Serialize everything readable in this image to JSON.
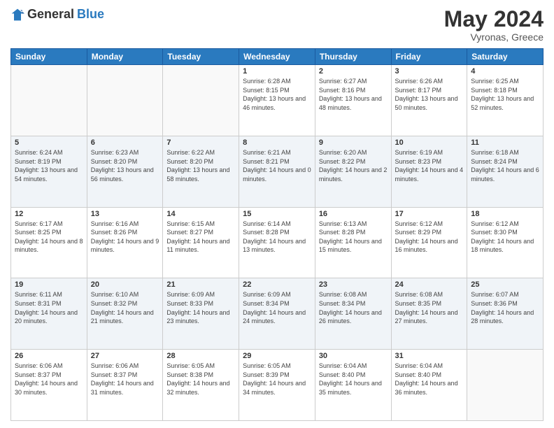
{
  "header": {
    "logo_general": "General",
    "logo_blue": "Blue",
    "month_year": "May 2024",
    "location": "Vyronas, Greece"
  },
  "weekdays": [
    "Sunday",
    "Monday",
    "Tuesday",
    "Wednesday",
    "Thursday",
    "Friday",
    "Saturday"
  ],
  "weeks": [
    [
      {
        "day": "",
        "sunrise": "",
        "sunset": "",
        "daylight": ""
      },
      {
        "day": "",
        "sunrise": "",
        "sunset": "",
        "daylight": ""
      },
      {
        "day": "",
        "sunrise": "",
        "sunset": "",
        "daylight": ""
      },
      {
        "day": "1",
        "sunrise": "Sunrise: 6:28 AM",
        "sunset": "Sunset: 8:15 PM",
        "daylight": "Daylight: 13 hours and 46 minutes."
      },
      {
        "day": "2",
        "sunrise": "Sunrise: 6:27 AM",
        "sunset": "Sunset: 8:16 PM",
        "daylight": "Daylight: 13 hours and 48 minutes."
      },
      {
        "day": "3",
        "sunrise": "Sunrise: 6:26 AM",
        "sunset": "Sunset: 8:17 PM",
        "daylight": "Daylight: 13 hours and 50 minutes."
      },
      {
        "day": "4",
        "sunrise": "Sunrise: 6:25 AM",
        "sunset": "Sunset: 8:18 PM",
        "daylight": "Daylight: 13 hours and 52 minutes."
      }
    ],
    [
      {
        "day": "5",
        "sunrise": "Sunrise: 6:24 AM",
        "sunset": "Sunset: 8:19 PM",
        "daylight": "Daylight: 13 hours and 54 minutes."
      },
      {
        "day": "6",
        "sunrise": "Sunrise: 6:23 AM",
        "sunset": "Sunset: 8:20 PM",
        "daylight": "Daylight: 13 hours and 56 minutes."
      },
      {
        "day": "7",
        "sunrise": "Sunrise: 6:22 AM",
        "sunset": "Sunset: 8:20 PM",
        "daylight": "Daylight: 13 hours and 58 minutes."
      },
      {
        "day": "8",
        "sunrise": "Sunrise: 6:21 AM",
        "sunset": "Sunset: 8:21 PM",
        "daylight": "Daylight: 14 hours and 0 minutes."
      },
      {
        "day": "9",
        "sunrise": "Sunrise: 6:20 AM",
        "sunset": "Sunset: 8:22 PM",
        "daylight": "Daylight: 14 hours and 2 minutes."
      },
      {
        "day": "10",
        "sunrise": "Sunrise: 6:19 AM",
        "sunset": "Sunset: 8:23 PM",
        "daylight": "Daylight: 14 hours and 4 minutes."
      },
      {
        "day": "11",
        "sunrise": "Sunrise: 6:18 AM",
        "sunset": "Sunset: 8:24 PM",
        "daylight": "Daylight: 14 hours and 6 minutes."
      }
    ],
    [
      {
        "day": "12",
        "sunrise": "Sunrise: 6:17 AM",
        "sunset": "Sunset: 8:25 PM",
        "daylight": "Daylight: 14 hours and 8 minutes."
      },
      {
        "day": "13",
        "sunrise": "Sunrise: 6:16 AM",
        "sunset": "Sunset: 8:26 PM",
        "daylight": "Daylight: 14 hours and 9 minutes."
      },
      {
        "day": "14",
        "sunrise": "Sunrise: 6:15 AM",
        "sunset": "Sunset: 8:27 PM",
        "daylight": "Daylight: 14 hours and 11 minutes."
      },
      {
        "day": "15",
        "sunrise": "Sunrise: 6:14 AM",
        "sunset": "Sunset: 8:28 PM",
        "daylight": "Daylight: 14 hours and 13 minutes."
      },
      {
        "day": "16",
        "sunrise": "Sunrise: 6:13 AM",
        "sunset": "Sunset: 8:28 PM",
        "daylight": "Daylight: 14 hours and 15 minutes."
      },
      {
        "day": "17",
        "sunrise": "Sunrise: 6:12 AM",
        "sunset": "Sunset: 8:29 PM",
        "daylight": "Daylight: 14 hours and 16 minutes."
      },
      {
        "day": "18",
        "sunrise": "Sunrise: 6:12 AM",
        "sunset": "Sunset: 8:30 PM",
        "daylight": "Daylight: 14 hours and 18 minutes."
      }
    ],
    [
      {
        "day": "19",
        "sunrise": "Sunrise: 6:11 AM",
        "sunset": "Sunset: 8:31 PM",
        "daylight": "Daylight: 14 hours and 20 minutes."
      },
      {
        "day": "20",
        "sunrise": "Sunrise: 6:10 AM",
        "sunset": "Sunset: 8:32 PM",
        "daylight": "Daylight: 14 hours and 21 minutes."
      },
      {
        "day": "21",
        "sunrise": "Sunrise: 6:09 AM",
        "sunset": "Sunset: 8:33 PM",
        "daylight": "Daylight: 14 hours and 23 minutes."
      },
      {
        "day": "22",
        "sunrise": "Sunrise: 6:09 AM",
        "sunset": "Sunset: 8:34 PM",
        "daylight": "Daylight: 14 hours and 24 minutes."
      },
      {
        "day": "23",
        "sunrise": "Sunrise: 6:08 AM",
        "sunset": "Sunset: 8:34 PM",
        "daylight": "Daylight: 14 hours and 26 minutes."
      },
      {
        "day": "24",
        "sunrise": "Sunrise: 6:08 AM",
        "sunset": "Sunset: 8:35 PM",
        "daylight": "Daylight: 14 hours and 27 minutes."
      },
      {
        "day": "25",
        "sunrise": "Sunrise: 6:07 AM",
        "sunset": "Sunset: 8:36 PM",
        "daylight": "Daylight: 14 hours and 28 minutes."
      }
    ],
    [
      {
        "day": "26",
        "sunrise": "Sunrise: 6:06 AM",
        "sunset": "Sunset: 8:37 PM",
        "daylight": "Daylight: 14 hours and 30 minutes."
      },
      {
        "day": "27",
        "sunrise": "Sunrise: 6:06 AM",
        "sunset": "Sunset: 8:37 PM",
        "daylight": "Daylight: 14 hours and 31 minutes."
      },
      {
        "day": "28",
        "sunrise": "Sunrise: 6:05 AM",
        "sunset": "Sunset: 8:38 PM",
        "daylight": "Daylight: 14 hours and 32 minutes."
      },
      {
        "day": "29",
        "sunrise": "Sunrise: 6:05 AM",
        "sunset": "Sunset: 8:39 PM",
        "daylight": "Daylight: 14 hours and 34 minutes."
      },
      {
        "day": "30",
        "sunrise": "Sunrise: 6:04 AM",
        "sunset": "Sunset: 8:40 PM",
        "daylight": "Daylight: 14 hours and 35 minutes."
      },
      {
        "day": "31",
        "sunrise": "Sunrise: 6:04 AM",
        "sunset": "Sunset: 8:40 PM",
        "daylight": "Daylight: 14 hours and 36 minutes."
      },
      {
        "day": "",
        "sunrise": "",
        "sunset": "",
        "daylight": ""
      }
    ]
  ]
}
